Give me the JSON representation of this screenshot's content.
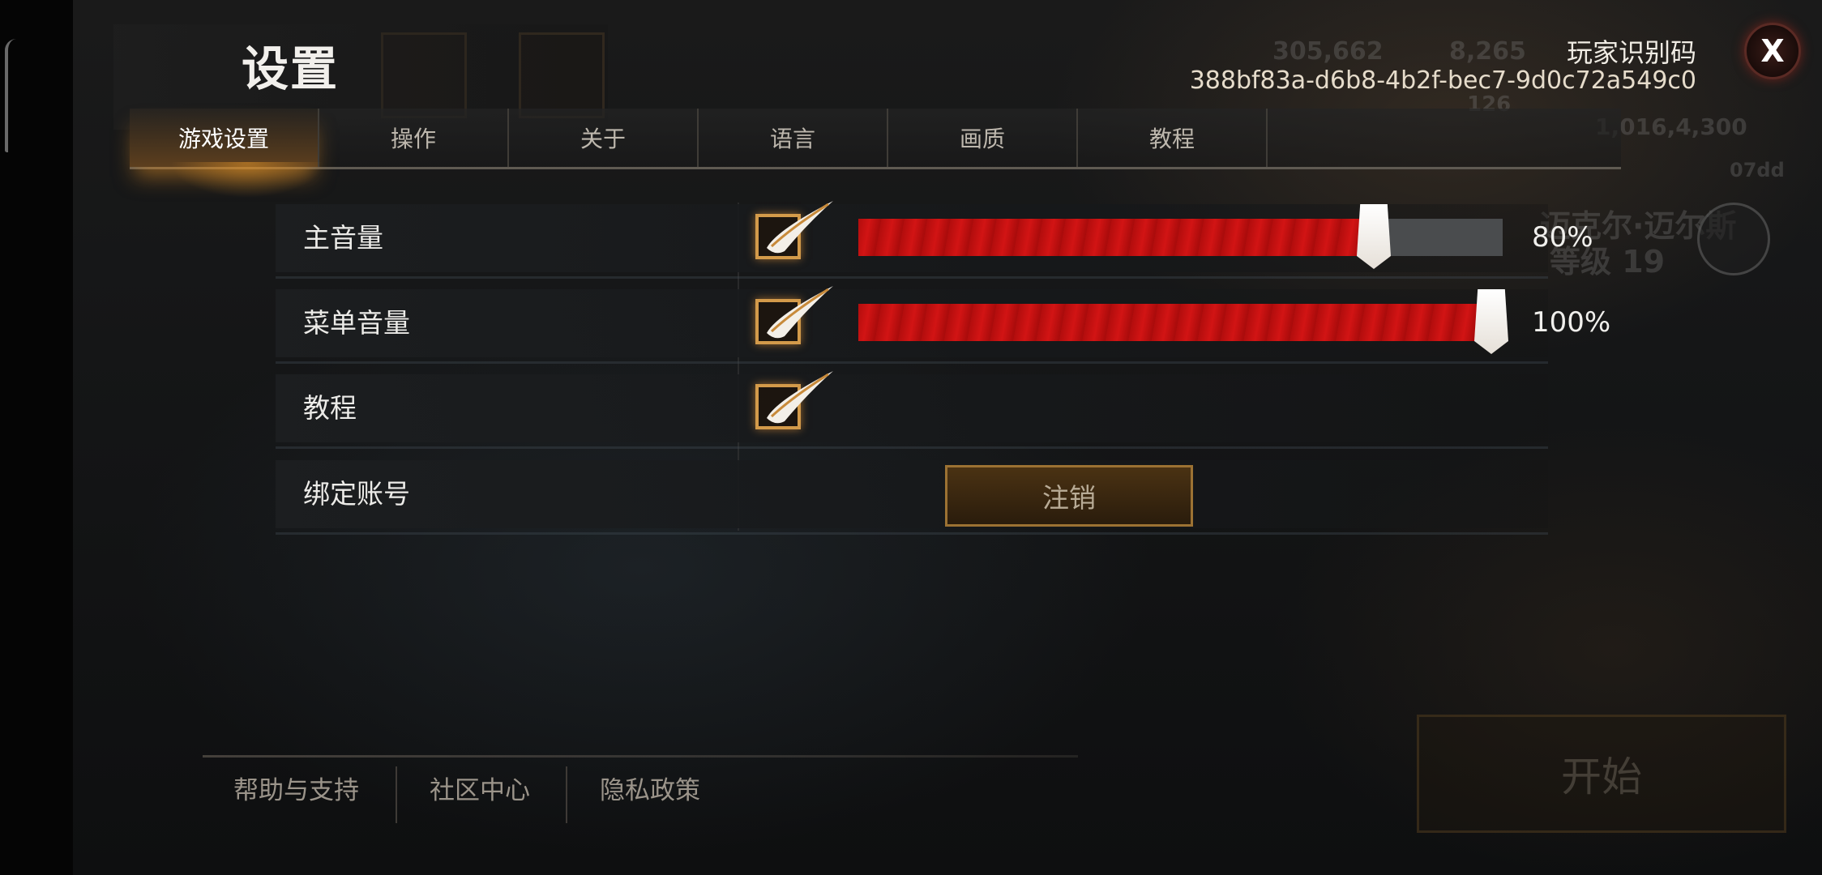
{
  "header": {
    "title": "设置",
    "player_id_label": "玩家识别码",
    "player_id": "388bf83a-d6b8-4b2f-bec7-9d0c72a549c0",
    "close_label": "X"
  },
  "tabs": [
    {
      "label": "游戏设置",
      "active": true
    },
    {
      "label": "操作"
    },
    {
      "label": "关于"
    },
    {
      "label": "语言"
    },
    {
      "label": "画质"
    },
    {
      "label": "教程"
    }
  ],
  "settings": {
    "master_volume": {
      "label": "主音量",
      "enabled": true,
      "value": 0.8,
      "value_text": "80%"
    },
    "menu_volume": {
      "label": "菜单音量",
      "enabled": true,
      "value": 1.0,
      "value_text": "100%"
    },
    "tutorial": {
      "label": "教程",
      "enabled": true
    },
    "bind_account": {
      "label": "绑定账号",
      "button_label": "注销"
    }
  },
  "footer": {
    "help": "帮助与支持",
    "community": "社区中心",
    "privacy": "隐私政策"
  },
  "background": {
    "currency_1": "305,662",
    "currency_2": "8,265",
    "currency_3": "126",
    "points": "1,016,4,300",
    "code_fragment": "07dd",
    "character_name": "迈克尔·迈尔斯",
    "level_text": "等级 19",
    "start_label": "开始"
  },
  "colors": {
    "accent": "#d39a4a",
    "slider_fill": "#c81212",
    "slider_track": "#4a4c4e"
  }
}
